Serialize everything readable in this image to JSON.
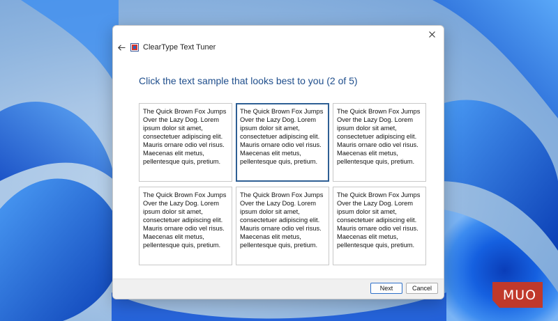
{
  "dialog": {
    "title": "ClearType Text Tuner",
    "instruction": "Click the text sample that looks best to you (2 of 5)",
    "selected_index": 1,
    "samples": [
      "The Quick Brown Fox Jumps Over the Lazy Dog. Lorem ipsum dolor sit amet, consectetuer adipiscing elit. Mauris ornare odio vel risus. Maecenas elit metus, pellentesque quis, pretium.",
      "The Quick Brown Fox Jumps Over the Lazy Dog. Lorem ipsum dolor sit amet, consectetuer adipiscing elit. Mauris ornare odio vel risus. Maecenas elit metus, pellentesque quis, pretium.",
      "The Quick Brown Fox Jumps Over the Lazy Dog. Lorem ipsum dolor sit amet, consectetuer adipiscing elit. Mauris ornare odio vel risus. Maecenas elit metus, pellentesque quis, pretium.",
      "The Quick Brown Fox Jumps Over the Lazy Dog. Lorem ipsum dolor sit amet, consectetuer adipiscing elit. Mauris ornare odio vel risus. Maecenas elit metus, pellentesque quis, pretium.",
      "The Quick Brown Fox Jumps Over the Lazy Dog. Lorem ipsum dolor sit amet, consectetuer adipiscing elit. Mauris ornare odio vel risus. Maecenas elit metus, pellentesque quis, pretium.",
      "The Quick Brown Fox Jumps Over the Lazy Dog. Lorem ipsum dolor sit amet, consectetuer adipiscing elit. Mauris ornare odio vel risus. Maecenas elit metus, pellentesque quis, pretium."
    ],
    "buttons": {
      "next": "Next",
      "cancel": "Cancel"
    }
  },
  "icons": {
    "close": "close-icon",
    "back": "back-arrow-icon",
    "app": "cleartype-icon"
  },
  "colors": {
    "instruction_text": "#1f4e8c",
    "selected_border": "#2e5f94",
    "logo_red": "#c0392b"
  },
  "watermark": {
    "logo_text": "MUO"
  }
}
